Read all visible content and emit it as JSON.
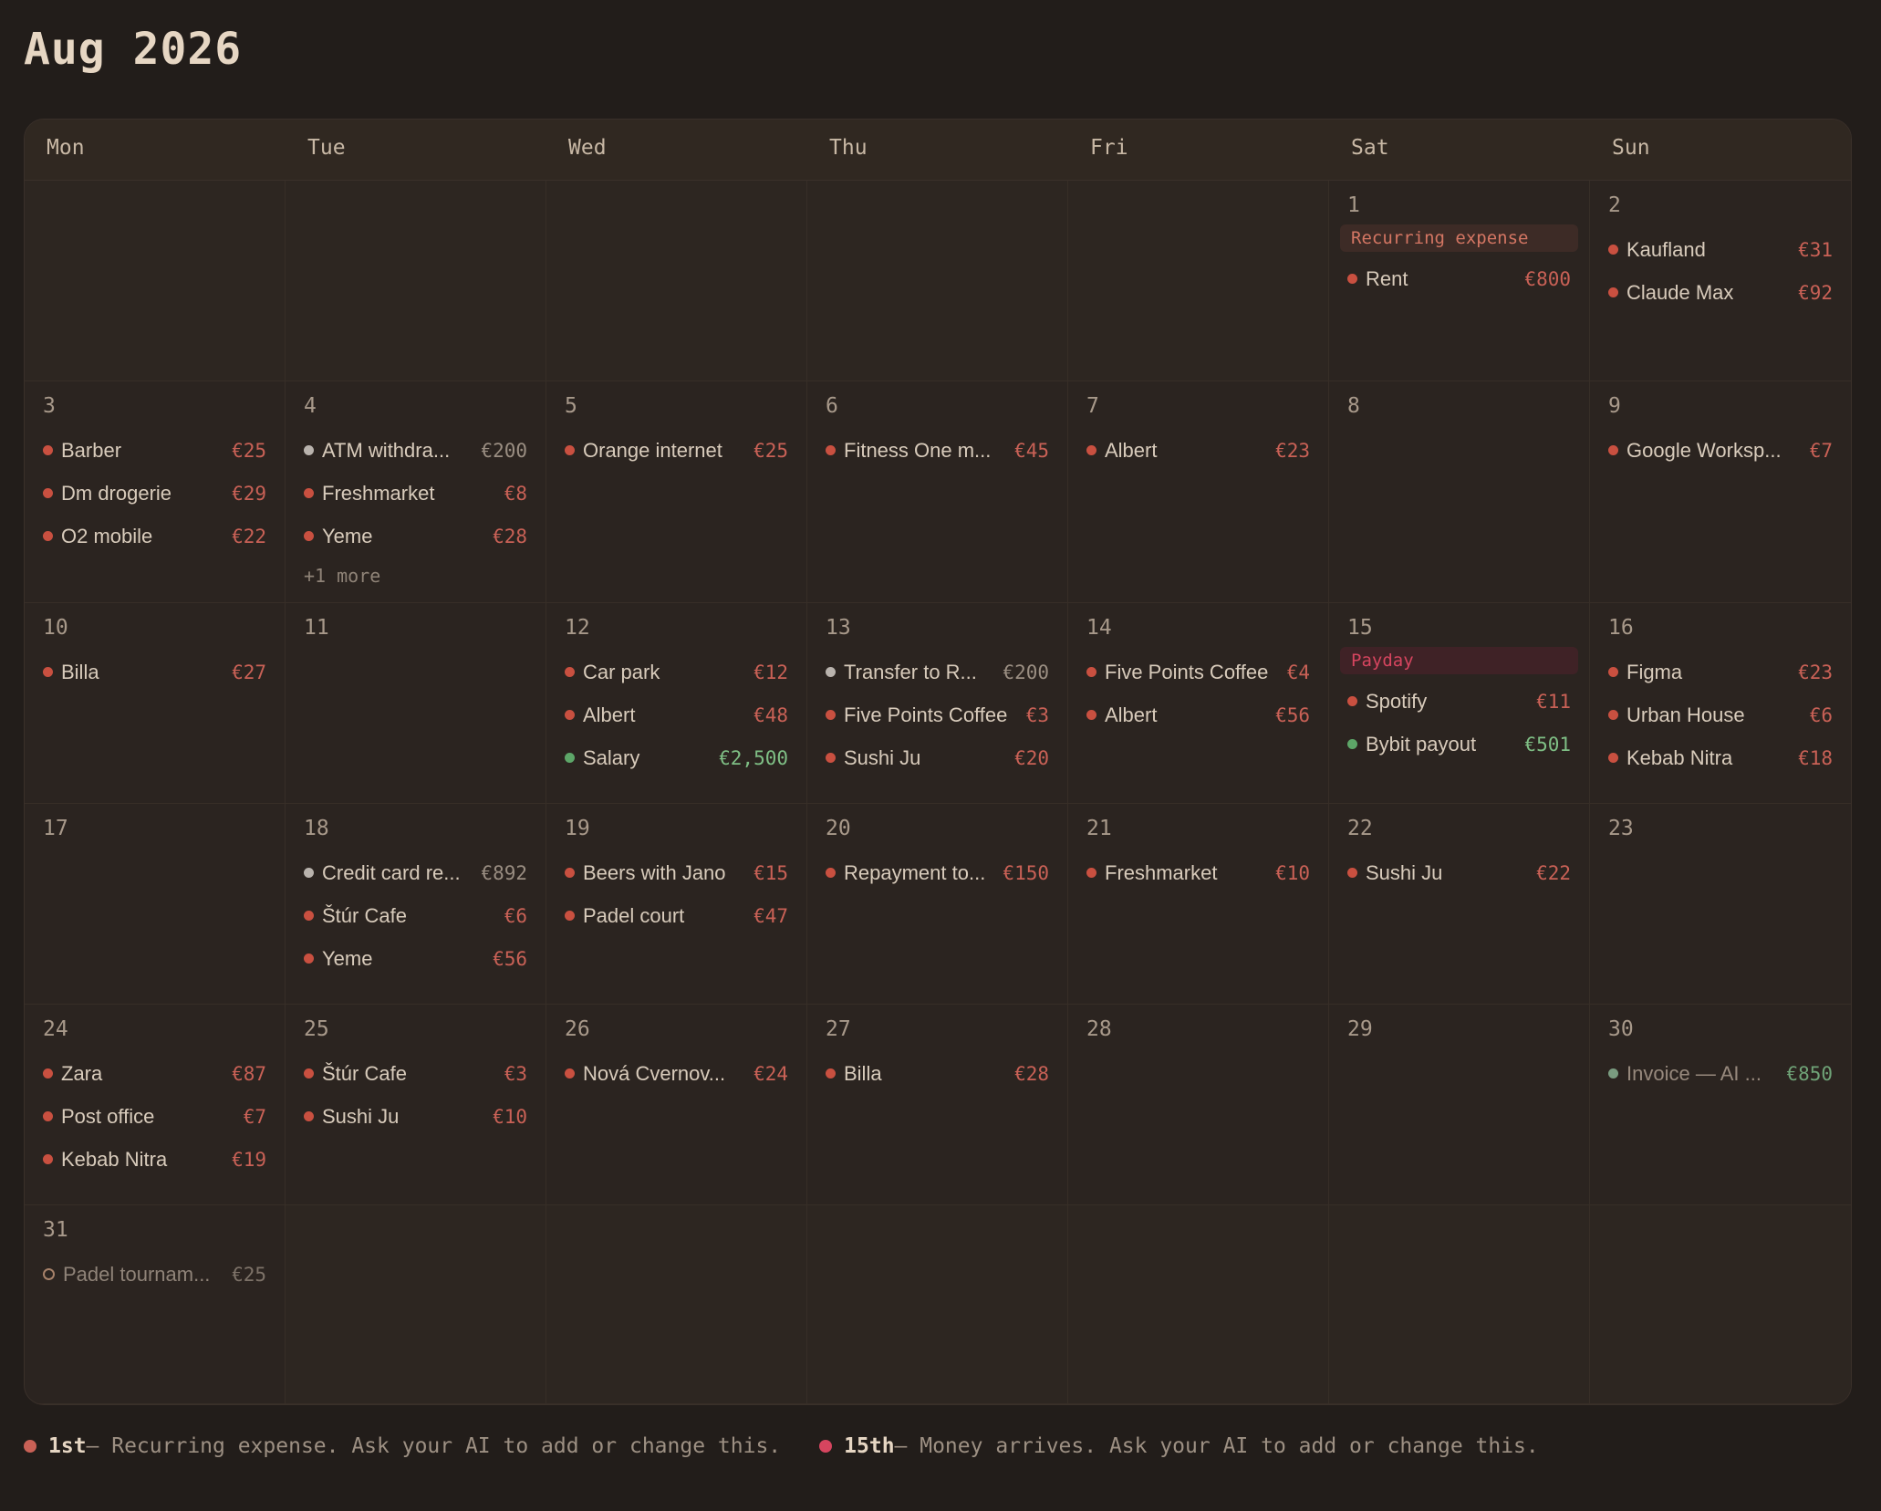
{
  "title": "Aug 2026",
  "weekdays": [
    "Mon",
    "Tue",
    "Wed",
    "Thu",
    "Fri",
    "Sat",
    "Sun"
  ],
  "colors": {
    "expense": "#c95040",
    "transfer": "#b9b3ad",
    "income": "#5da668",
    "recurring": "#c96156",
    "payday": "#d6455f"
  },
  "cells": [
    {
      "day": "",
      "events": []
    },
    {
      "day": "",
      "events": []
    },
    {
      "day": "",
      "events": []
    },
    {
      "day": "",
      "events": []
    },
    {
      "day": "",
      "events": []
    },
    {
      "day": "1",
      "pill": {
        "label": "Recurring expense",
        "kind": "rec"
      },
      "events": [
        {
          "name": "Rent",
          "amount": "€800",
          "kind": "red"
        }
      ]
    },
    {
      "day": "2",
      "events": [
        {
          "name": "Kaufland",
          "amount": "€31",
          "kind": "red"
        },
        {
          "name": "Claude Max",
          "amount": "€92",
          "kind": "red"
        }
      ]
    },
    {
      "day": "3",
      "events": [
        {
          "name": "Barber",
          "amount": "€25",
          "kind": "red"
        },
        {
          "name": "Dm drogerie",
          "amount": "€29",
          "kind": "red"
        },
        {
          "name": "O2 mobile",
          "amount": "€22",
          "kind": "red"
        }
      ]
    },
    {
      "day": "4",
      "events": [
        {
          "name": "ATM withdra...",
          "amount": "€200",
          "kind": "grey"
        },
        {
          "name": "Freshmarket",
          "amount": "€8",
          "kind": "red"
        },
        {
          "name": "Yeme",
          "amount": "€28",
          "kind": "red"
        }
      ],
      "more": "+1 more"
    },
    {
      "day": "5",
      "events": [
        {
          "name": "Orange internet",
          "amount": "€25",
          "kind": "red"
        }
      ]
    },
    {
      "day": "6",
      "events": [
        {
          "name": "Fitness One m...",
          "amount": "€45",
          "kind": "red"
        }
      ]
    },
    {
      "day": "7",
      "events": [
        {
          "name": "Albert",
          "amount": "€23",
          "kind": "red"
        }
      ]
    },
    {
      "day": "8",
      "events": []
    },
    {
      "day": "9",
      "events": [
        {
          "name": "Google Worksp...",
          "amount": "€7",
          "kind": "red"
        }
      ]
    },
    {
      "day": "10",
      "events": [
        {
          "name": "Billa",
          "amount": "€27",
          "kind": "red"
        }
      ]
    },
    {
      "day": "11",
      "events": []
    },
    {
      "day": "12",
      "events": [
        {
          "name": "Car park",
          "amount": "€12",
          "kind": "red"
        },
        {
          "name": "Albert",
          "amount": "€48",
          "kind": "red"
        },
        {
          "name": "Salary",
          "amount": "€2,500",
          "kind": "green"
        }
      ]
    },
    {
      "day": "13",
      "events": [
        {
          "name": "Transfer to R...",
          "amount": "€200",
          "kind": "grey"
        },
        {
          "name": "Five Points Coffee",
          "amount": "€3",
          "kind": "red"
        },
        {
          "name": "Sushi Ju",
          "amount": "€20",
          "kind": "red"
        }
      ]
    },
    {
      "day": "14",
      "events": [
        {
          "name": "Five Points Coffee",
          "amount": "€4",
          "kind": "red"
        },
        {
          "name": "Albert",
          "amount": "€56",
          "kind": "red"
        }
      ]
    },
    {
      "day": "15",
      "pill": {
        "label": "Payday",
        "kind": "pay"
      },
      "events": [
        {
          "name": "Spotify",
          "amount": "€11",
          "kind": "red"
        },
        {
          "name": "Bybit payout",
          "amount": "€501",
          "kind": "green"
        }
      ]
    },
    {
      "day": "16",
      "events": [
        {
          "name": "Figma",
          "amount": "€23",
          "kind": "red"
        },
        {
          "name": "Urban House",
          "amount": "€6",
          "kind": "red"
        },
        {
          "name": "Kebab Nitra",
          "amount": "€18",
          "kind": "red"
        }
      ]
    },
    {
      "day": "17",
      "events": []
    },
    {
      "day": "18",
      "events": [
        {
          "name": "Credit card re...",
          "amount": "€892",
          "kind": "grey"
        },
        {
          "name": "Štúr Cafe",
          "amount": "€6",
          "kind": "red"
        },
        {
          "name": "Yeme",
          "amount": "€56",
          "kind": "red"
        }
      ]
    },
    {
      "day": "19",
      "events": [
        {
          "name": "Beers with Jano",
          "amount": "€15",
          "kind": "red"
        },
        {
          "name": "Padel court",
          "amount": "€47",
          "kind": "red"
        }
      ]
    },
    {
      "day": "20",
      "events": [
        {
          "name": "Repayment to...",
          "amount": "€150",
          "kind": "red"
        }
      ]
    },
    {
      "day": "21",
      "events": [
        {
          "name": "Freshmarket",
          "amount": "€10",
          "kind": "red"
        }
      ]
    },
    {
      "day": "22",
      "events": [
        {
          "name": "Sushi Ju",
          "amount": "€22",
          "kind": "red"
        }
      ]
    },
    {
      "day": "23",
      "events": []
    },
    {
      "day": "24",
      "events": [
        {
          "name": "Zara",
          "amount": "€87",
          "kind": "red"
        },
        {
          "name": "Post office",
          "amount": "€7",
          "kind": "red"
        },
        {
          "name": "Kebab Nitra",
          "amount": "€19",
          "kind": "red"
        }
      ]
    },
    {
      "day": "25",
      "events": [
        {
          "name": "Štúr Cafe",
          "amount": "€3",
          "kind": "red"
        },
        {
          "name": "Sushi Ju",
          "amount": "€10",
          "kind": "red"
        }
      ]
    },
    {
      "day": "26",
      "events": [
        {
          "name": "Nová Cvernov...",
          "amount": "€24",
          "kind": "red"
        }
      ]
    },
    {
      "day": "27",
      "events": [
        {
          "name": "Billa",
          "amount": "€28",
          "kind": "red"
        }
      ]
    },
    {
      "day": "28",
      "events": []
    },
    {
      "day": "29",
      "events": []
    },
    {
      "day": "30",
      "events": [
        {
          "name": "Invoice — AI ...",
          "amount": "€850",
          "kind": "sage"
        }
      ]
    },
    {
      "day": "31",
      "events": [
        {
          "name": "Padel tournam...",
          "amount": "€25",
          "kind": "hollow"
        }
      ]
    },
    {
      "day": "",
      "events": []
    },
    {
      "day": "",
      "events": []
    },
    {
      "day": "",
      "events": []
    },
    {
      "day": "",
      "events": []
    },
    {
      "day": "",
      "events": []
    },
    {
      "day": "",
      "events": []
    }
  ],
  "legend": [
    {
      "strong": "1st",
      "text": " — Recurring expense. Ask your AI to add or change this.",
      "color": "#c96156"
    },
    {
      "strong": "15th",
      "text": " — Money arrives. Ask your AI to add or change this.",
      "color": "#d6455f"
    }
  ]
}
